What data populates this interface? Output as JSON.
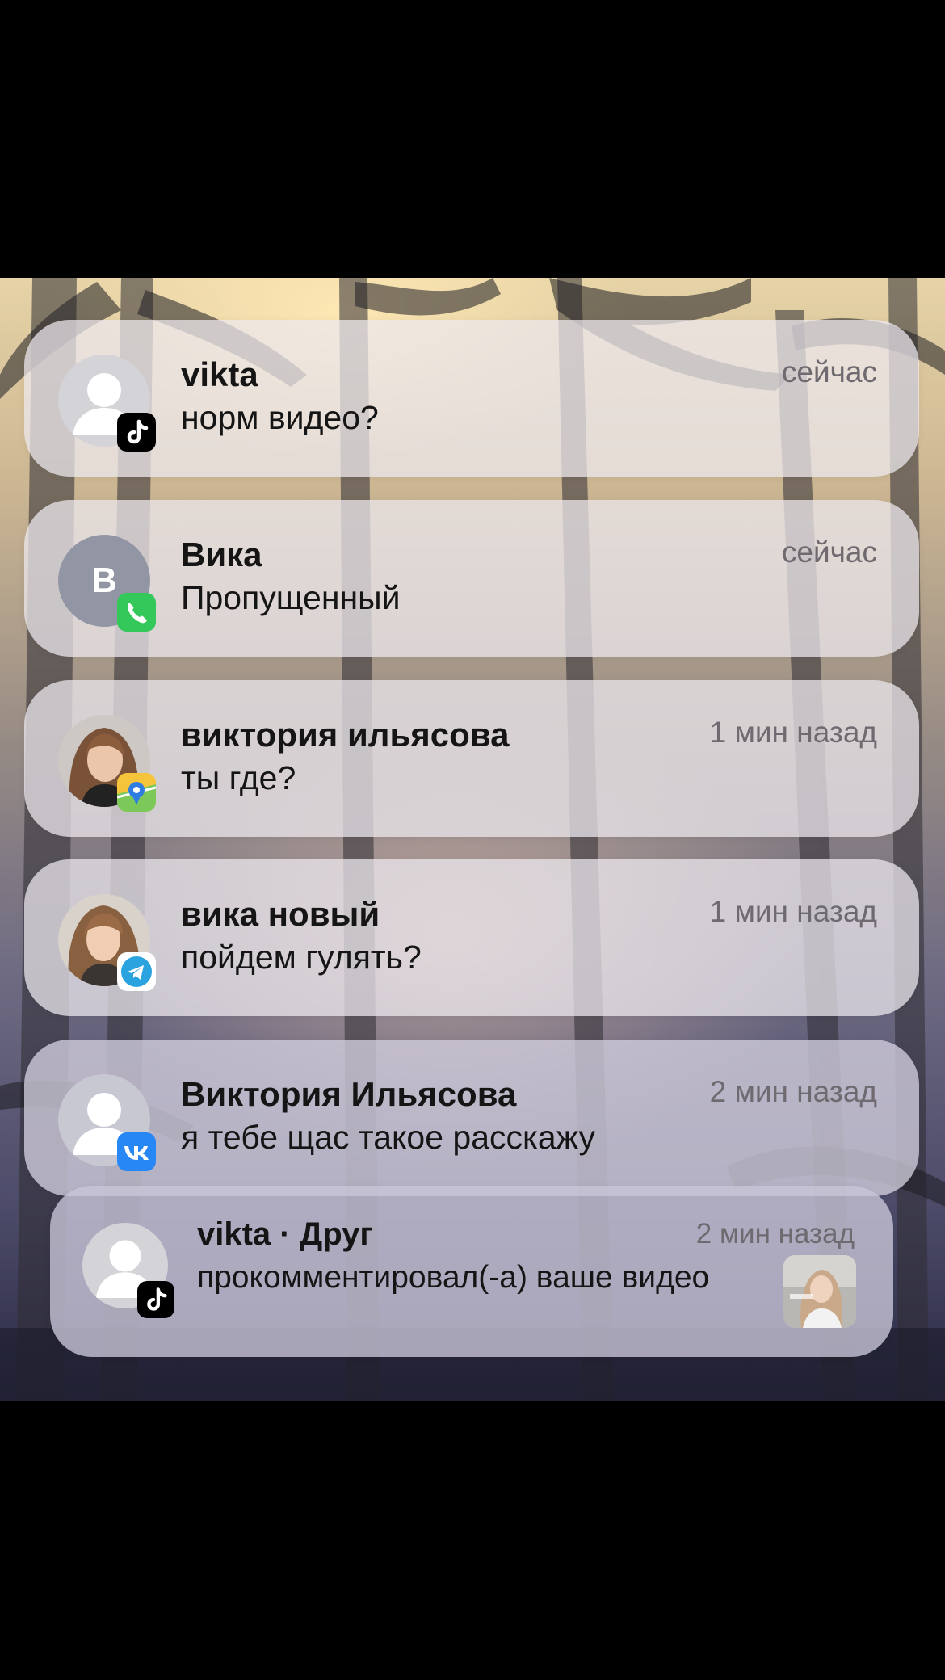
{
  "colors": {
    "tiktok_badge": "#000000",
    "phone_badge": "#34c759",
    "telegram_badge": "#2aa3df",
    "vk_badge": "#2787f5",
    "notification_background": "rgba(236,232,238,0.74)"
  },
  "notifications": [
    {
      "app_icon": "tiktok-icon",
      "avatar": "generic-person",
      "title": "vikta",
      "time": "сейчас",
      "body": "норм видео?"
    },
    {
      "app_icon": "phone-icon",
      "avatar": "letter",
      "avatar_letter": "В",
      "title": "Вика",
      "time": "сейчас",
      "body": "Пропущенный"
    },
    {
      "app_icon": "maps-icon",
      "avatar": "photo",
      "title": "виктория ильясова",
      "time": "1 мин назад",
      "body": "ты где?"
    },
    {
      "app_icon": "telegram-icon",
      "avatar": "photo",
      "title": "вика новый",
      "time": "1 мин назад",
      "body": "пойдем гулять?"
    },
    {
      "app_icon": "vk-icon",
      "avatar": "generic-person",
      "title": "Виктория Ильясова",
      "time": "2 мин назад",
      "body": "я тебе щас такое расскажу"
    },
    {
      "app_icon": "tiktok-icon",
      "avatar": "generic-person",
      "title": "vikta · Друг",
      "time": "2 мин назад",
      "body": "прокомментировал(-а) ваше видео",
      "thumbnail": "video-thumbnail"
    }
  ]
}
